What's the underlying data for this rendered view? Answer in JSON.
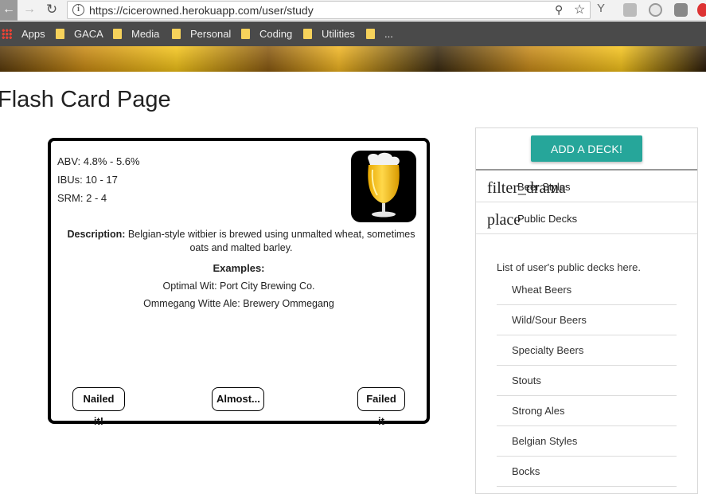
{
  "browser": {
    "url": "https://cicerowned.herokuapp.com/user/study",
    "bookmarks": [
      "Apps",
      "GACA",
      "Media",
      "Personal",
      "Coding",
      "Utilities",
      "..."
    ]
  },
  "page": {
    "title": "Flash Card Page"
  },
  "card": {
    "abv": "ABV: 4.8% - 5.6%",
    "ibus": "IBUs: 10 - 17",
    "srm": "SRM: 2 - 4",
    "description_label": "Description:",
    "description": "Belgian-style witbier is brewed using unmalted wheat, sometimes oats and malted barley.",
    "examples_title": "Examples:",
    "examples": [
      "Optimal Wit: Port City Brewing Co.",
      "Ommegang Witte Ale: Brewery Ommegang"
    ],
    "buttons": {
      "nailed": "Nailed it!",
      "almost": "Almost...",
      "failed": "Failed it"
    },
    "icon": "wheat-beer-glass-icon"
  },
  "decks": {
    "add_button": "ADD A DECK!",
    "rows": [
      {
        "icon_text": "filter_drama",
        "label": "Beer Styles"
      },
      {
        "icon_text": "place",
        "label": "Public Decks"
      }
    ],
    "list_intro": "List of user's public decks here.",
    "items": [
      "Wheat Beers",
      "Wild/Sour Beers",
      "Specialty Beers",
      "Stouts",
      "Strong Ales",
      "Belgian Styles",
      "Bocks"
    ]
  },
  "colors": {
    "accent": "#26a69a",
    "bookmark_bar": "#4a4a4a",
    "beer": "#f5c518"
  }
}
